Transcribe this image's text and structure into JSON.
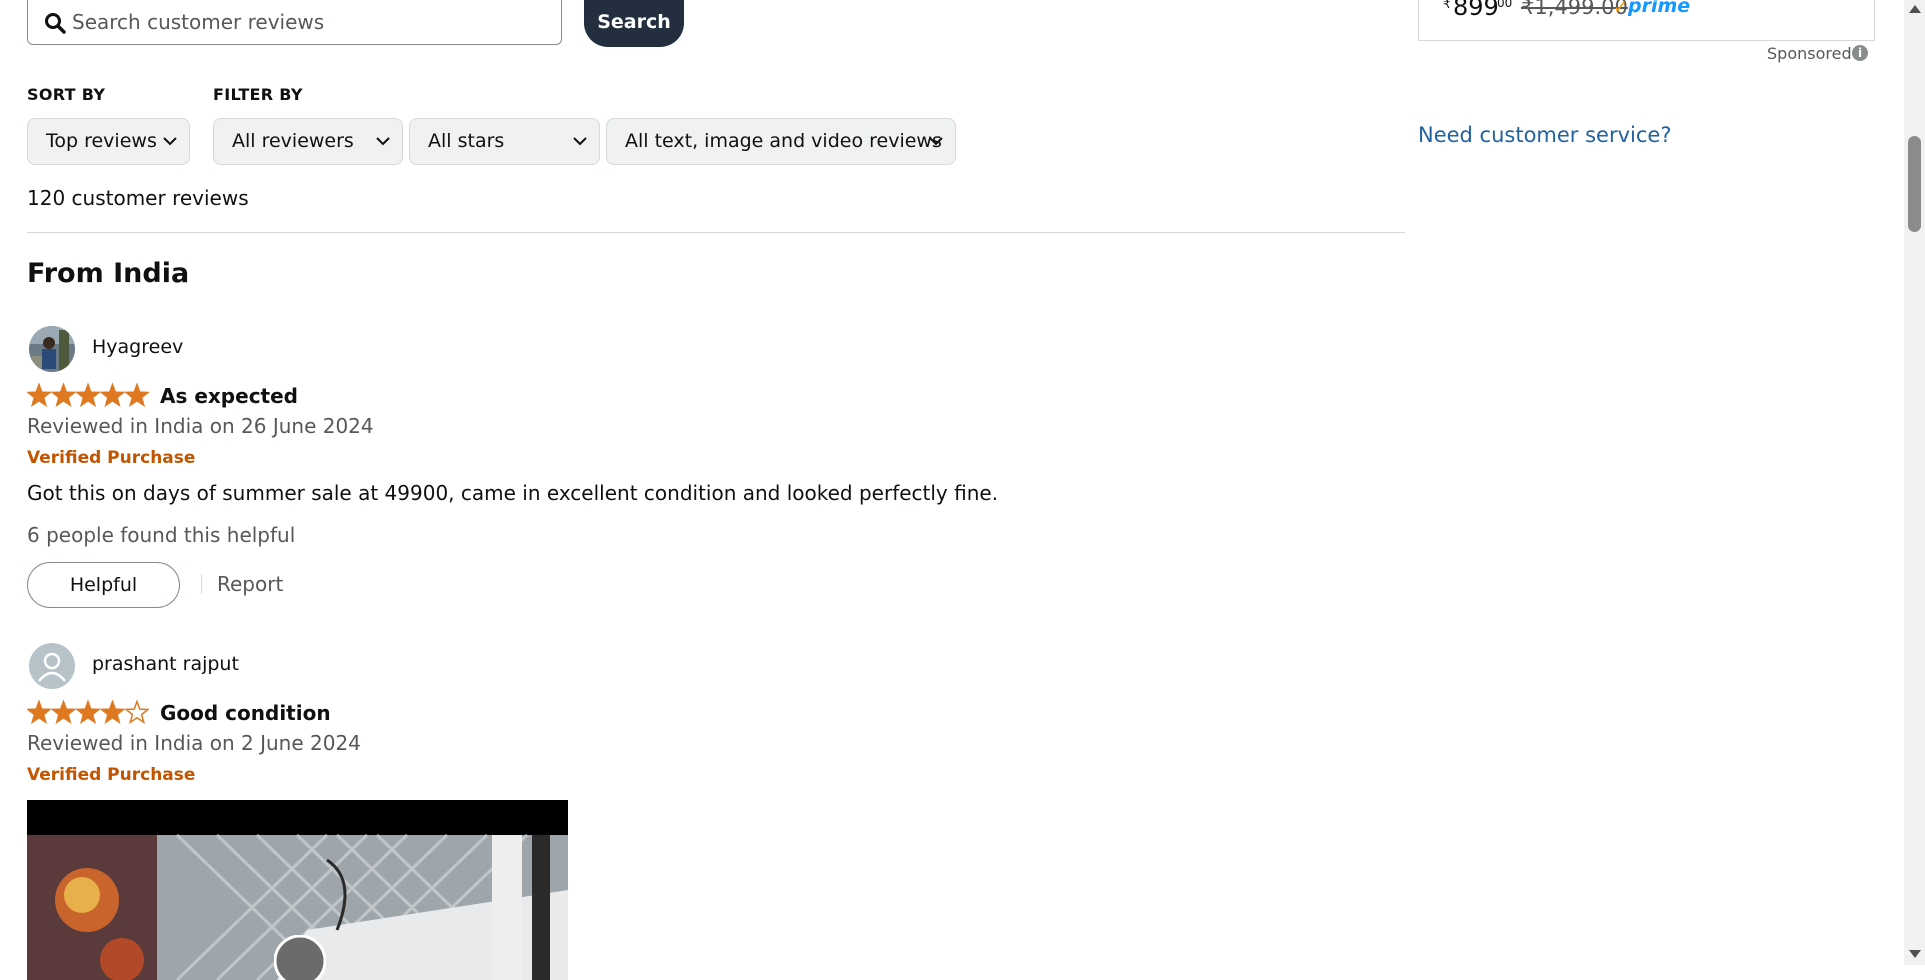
{
  "search": {
    "placeholder": "Search customer reviews",
    "button": "Search"
  },
  "sort": {
    "label": "SORT BY",
    "value": "Top reviews"
  },
  "filter": {
    "label": "FILTER BY",
    "reviewers": "All reviewers",
    "stars": "All stars",
    "format": "All text, image and video reviews"
  },
  "review_count": "120 customer reviews",
  "section_title": "From India",
  "reviews": [
    {
      "name": "Hyagreev",
      "rating": 5,
      "title": "As expected",
      "date": "Reviewed in India on 26 June 2024",
      "verified": "Verified Purchase",
      "body": "Got this on days of summer sale at 49900, came in excellent condition and looked perfectly fine.",
      "helpful_count": "6 people found this helpful",
      "helpful_button": "Helpful",
      "report": "Report"
    },
    {
      "name": "prashant rajput",
      "rating": 4,
      "title": "Good condition",
      "date": "Reviewed in India on 2 June 2024",
      "verified": "Verified Purchase"
    }
  ],
  "sidebar": {
    "currency_symbol": "₹",
    "price_whole": "899",
    "price_fraction": "00",
    "price_old": "₹1,499.00",
    "prime": "prime",
    "sponsored": "Sponsored",
    "customer_service": "Need customer service?"
  },
  "colors": {
    "star": "#de7921",
    "verified": "#c45500",
    "link": "#2162a1",
    "search_button": "#232f3e"
  },
  "icons": [
    "search-icon",
    "chevron-down-icon",
    "star-icon",
    "info-icon",
    "avatar-placeholder-icon",
    "play-icon"
  ]
}
